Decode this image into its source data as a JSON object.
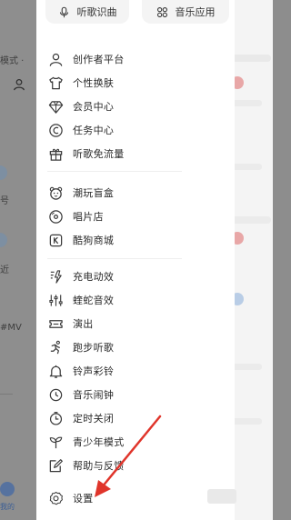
{
  "background": {
    "frag_mode": "模式 ·",
    "frag_a": "号",
    "frag_b": "近",
    "frag_mv": "#MV",
    "frag_mine": "我的"
  },
  "drawer": {
    "top_buttons": [
      {
        "label": "听歌识曲",
        "icon": "mic-icon"
      },
      {
        "label": "音乐应用",
        "icon": "grid-icon"
      }
    ],
    "groups": [
      [
        {
          "label": "创作者平台",
          "icon": "user-icon"
        },
        {
          "label": "个性换肤",
          "icon": "shirt-icon"
        },
        {
          "label": "会员中心",
          "icon": "diamond-icon"
        },
        {
          "label": "任务中心",
          "icon": "coin-icon"
        },
        {
          "label": "听歌免流量",
          "icon": "gift-icon"
        }
      ],
      [
        {
          "label": "潮玩盲盒",
          "icon": "bear-icon"
        },
        {
          "label": "唱片店",
          "icon": "disc-icon"
        },
        {
          "label": "酷狗商城",
          "icon": "shop-icon"
        }
      ],
      [
        {
          "label": "充电动效",
          "icon": "charge-icon"
        },
        {
          "label": "蝰蛇音效",
          "icon": "equalizer-icon"
        },
        {
          "label": "演出",
          "icon": "ticket-icon"
        },
        {
          "label": "跑步听歌",
          "icon": "run-icon"
        },
        {
          "label": "铃声彩铃",
          "icon": "bell-icon"
        },
        {
          "label": "音乐闹钟",
          "icon": "alarm-icon"
        },
        {
          "label": "定时关闭",
          "icon": "timer-icon"
        },
        {
          "label": "青少年模式",
          "icon": "sprout-icon"
        },
        {
          "label": "帮助与反馈",
          "icon": "feedback-icon"
        },
        {
          "label": "设置",
          "icon": "settings-icon"
        }
      ]
    ]
  },
  "annotation": {
    "arrow_color": "#e0352b"
  }
}
